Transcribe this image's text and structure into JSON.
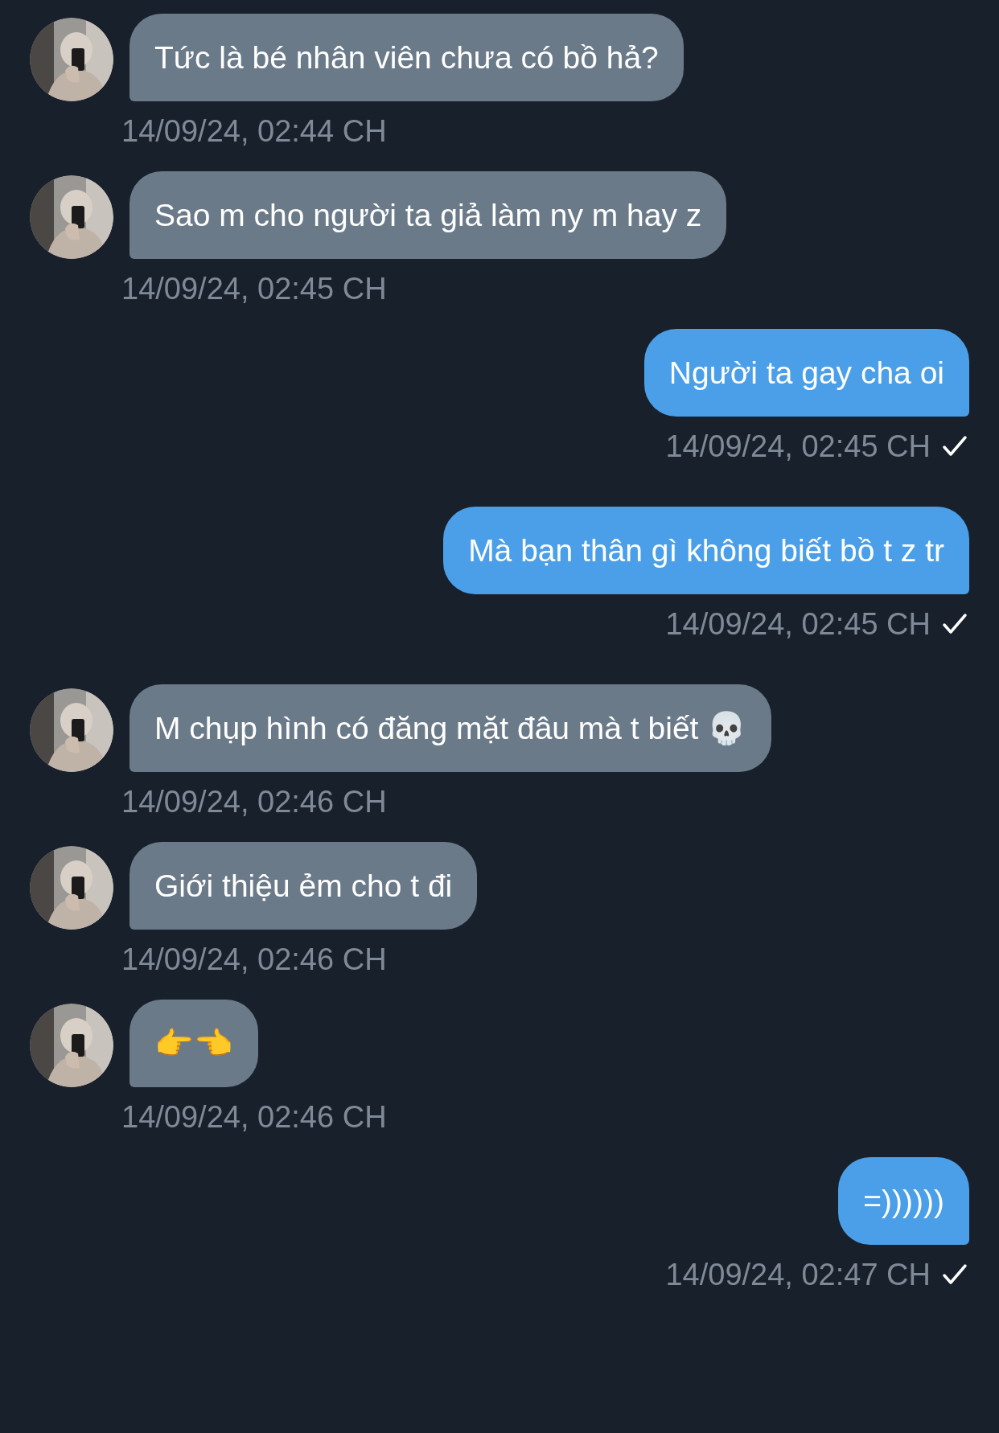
{
  "messages": [
    {
      "kind": "received",
      "text": "Tức là bé nhân viên chưa có bồ hả?",
      "time": "14/09/24, 02:44 CH"
    },
    {
      "kind": "received",
      "text": "Sao m cho người ta giả làm ny m hay z",
      "time": "14/09/24, 02:45 CH"
    },
    {
      "kind": "sent",
      "text": "Người ta gay cha oi",
      "time": "14/09/24, 02:45 CH"
    },
    {
      "kind": "sent",
      "text": "Mà bạn thân gì không biết bồ t z tr",
      "time": "14/09/24, 02:45 CH"
    },
    {
      "kind": "received",
      "text": "M chụp hình có đăng mặt đâu mà t biết 💀",
      "time": "14/09/24, 02:46 CH"
    },
    {
      "kind": "received",
      "text": "Giới thiệu ẻm cho t đi",
      "time": "14/09/24, 02:46 CH"
    },
    {
      "kind": "received",
      "text": "👉👈",
      "time": "14/09/24, 02:46 CH"
    },
    {
      "kind": "sent",
      "text": "=))))))",
      "time": "14/09/24, 02:47 CH"
    }
  ]
}
